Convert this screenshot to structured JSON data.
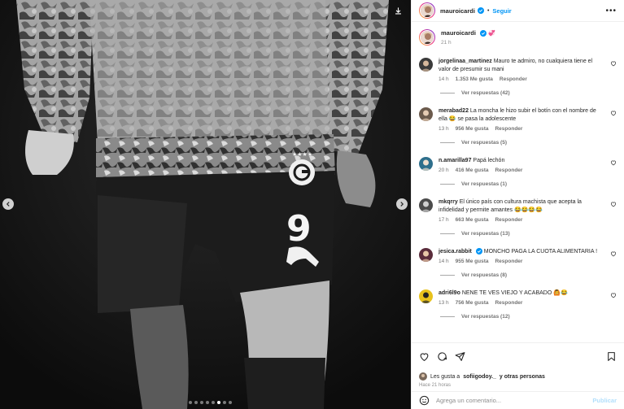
{
  "post": {
    "author": "mauroicardi",
    "follow_label": "Seguir",
    "separator": "•",
    "more_label": "•••",
    "caption_time": "21 h",
    "caption_emoji": "💞"
  },
  "comments": [
    {
      "user": "jorgelinaa_martinez",
      "text": "Mauro te admiro, no cualquiera tiene el valor de presumir su mani",
      "time": "14 h",
      "likes": "1.353 Me gusta",
      "reply": "Responder",
      "replies": "Ver respuestas (42)",
      "verified": false
    },
    {
      "user": "merabad22",
      "text": "La moncha le hizo subir el botín con el nombre de ella 😂 se pasa la adolescente",
      "time": "13 h",
      "likes": "956 Me gusta",
      "reply": "Responder",
      "replies": "Ver respuestas (5)",
      "verified": false
    },
    {
      "user": "n.amarilla97",
      "text": "Papá lechón",
      "time": "20 h",
      "likes": "416 Me gusta",
      "reply": "Responder",
      "replies": "Ver respuestas (1)",
      "verified": false
    },
    {
      "user": "mkqrry",
      "text": "El único país con cultura machista que acepta la infidelidad y permite amantes 😂😂😂😂",
      "time": "17 h",
      "likes": "663 Me gusta",
      "reply": "Responder",
      "replies": "Ver respuestas (13)",
      "verified": false
    },
    {
      "user": "jesica.rabbit",
      "text": "MONCHO PAGA LA CUOTA ALIMENTARIA !",
      "time": "14 h",
      "likes": "955 Me gusta",
      "reply": "Responder",
      "replies": "Ver respuestas (8)",
      "verified": true
    },
    {
      "user": "adri6l9o",
      "text": "NENE TE VES VIEJO Y ACABADO 🙆😂",
      "time": "13 h",
      "likes": "756 Me gusta",
      "reply": "Responder",
      "replies": "Ver respuestas (12)",
      "verified": false
    }
  ],
  "likes_row": {
    "prefix": "Les gusta a",
    "user": "sofiigodoy._",
    "suffix": "y otras personas",
    "time_ago": "Hace 21 horas"
  },
  "add_comment": {
    "placeholder": "Agrega un comentario...",
    "publish_label": "Publicar"
  },
  "jersey": {
    "number": "9"
  },
  "icons": {
    "like": "heart-icon",
    "comment": "comment-icon",
    "share": "send-icon",
    "save": "bookmark-icon",
    "emoji": "emoji-icon",
    "download": "download-icon",
    "prev": "chevron-left-icon",
    "next": "chevron-right-icon"
  },
  "colors": {
    "link": "#0095f6",
    "verified": "#0095f6",
    "muted": "#737373",
    "publish": "#b2dffc"
  },
  "carousel": {
    "count": 8,
    "active_index": 5
  }
}
